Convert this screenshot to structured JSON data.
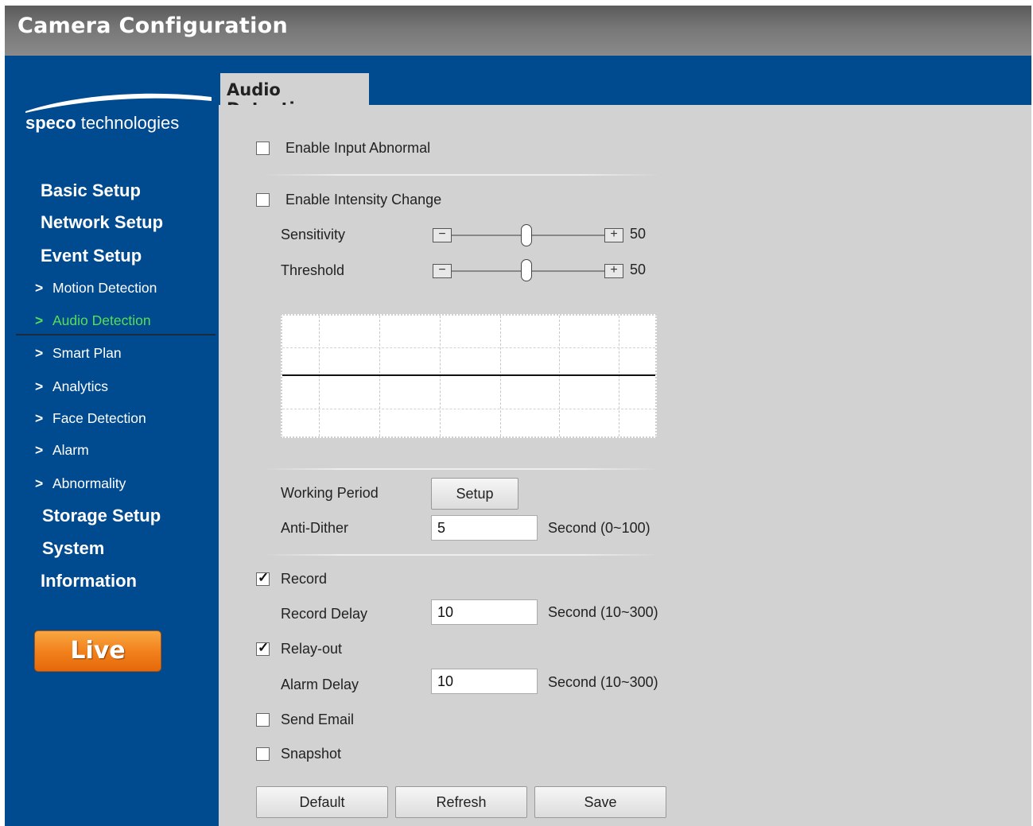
{
  "window": {
    "title": "Camera Configuration"
  },
  "brand": {
    "bold": "speco",
    "rest": " technologies"
  },
  "sidebar": {
    "main_items": [
      "Basic Setup",
      "Network Setup",
      "Event Setup",
      "Storage Setup",
      "System",
      "Information"
    ],
    "event_sub_items": [
      "Motion Detection",
      "Audio Detection",
      "Smart Plan",
      "Analytics",
      "Face Detection",
      "Alarm",
      "Abnormality"
    ],
    "active_sub_item": "Audio Detection",
    "chevron": ">",
    "live_label": "Live"
  },
  "tab": {
    "label": "Audio Detection"
  },
  "form": {
    "enable_input_abnormal": {
      "label": "Enable Input Abnormal",
      "checked": false
    },
    "enable_intensity_change": {
      "label": "Enable Intensity Change",
      "checked": false
    },
    "sensitivity": {
      "label": "Sensitivity",
      "value": "50",
      "minus": "−",
      "plus": "+"
    },
    "threshold": {
      "label": "Threshold",
      "value": "50",
      "minus": "−",
      "plus": "+"
    },
    "working_period": {
      "label": "Working Period",
      "button": "Setup"
    },
    "anti_dither": {
      "label": "Anti-Dither",
      "value": "5",
      "unit": "Second (0~100)"
    },
    "record": {
      "label": "Record",
      "checked": true
    },
    "record_delay": {
      "label": "Record Delay",
      "value": "10",
      "unit": "Second (10~300)"
    },
    "relay_out": {
      "label": "Relay-out",
      "checked": true
    },
    "alarm_delay": {
      "label": "Alarm Delay",
      "value": "10",
      "unit": "Second (10~300)"
    },
    "send_email": {
      "label": "Send Email",
      "checked": false
    },
    "snapshot": {
      "label": "Snapshot",
      "checked": false
    }
  },
  "buttons": {
    "default": "Default",
    "refresh": "Refresh",
    "save": "Save"
  },
  "colors": {
    "sidebar_bg": "#004a8f",
    "content_bg": "#d2d2d2",
    "active_nav": "#55e056",
    "live_orange": "#f2821d"
  }
}
